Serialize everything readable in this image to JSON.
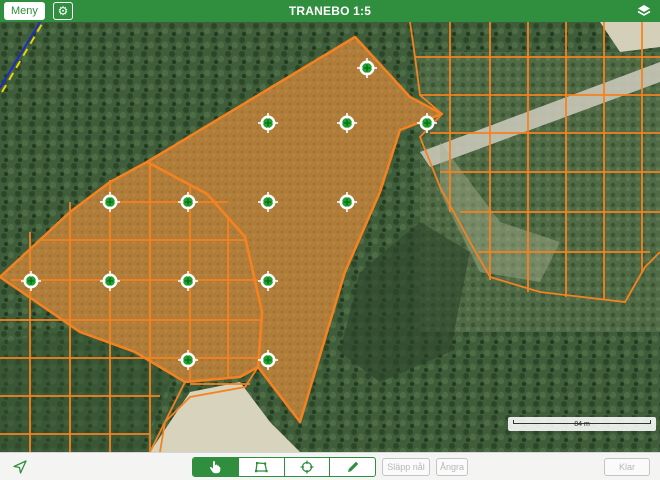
{
  "header": {
    "title": "TRANEBO 1:5",
    "menu_label": "Meny",
    "settings_icon": "gear-icon",
    "layers_icon": "layers-icon"
  },
  "map": {
    "scale_label": "84 m",
    "polygon_color": "#f58220",
    "marker_color": "#1fa22e"
  },
  "toolbar": {
    "locate_icon": "location-arrow-icon",
    "modes": [
      {
        "name": "select",
        "icon": "hand-pointer-icon",
        "active": true
      },
      {
        "name": "polygon",
        "icon": "polygon-icon",
        "active": false
      },
      {
        "name": "target",
        "icon": "crosshair-icon",
        "active": false
      },
      {
        "name": "edit",
        "icon": "pencil-icon",
        "active": false
      }
    ],
    "drop_pin_label": "Släpp nål",
    "undo_label": "Ångra",
    "done_label": "Klar"
  }
}
